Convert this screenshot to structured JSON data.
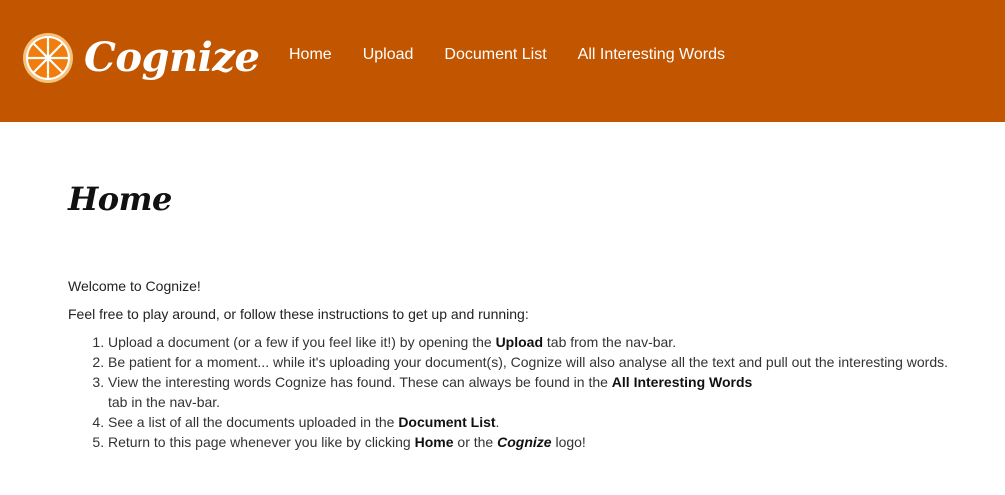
{
  "brand": {
    "name": "Cognize",
    "logo_icon": "orange-slice-icon"
  },
  "nav": {
    "items": [
      {
        "label": "Home"
      },
      {
        "label": "Upload"
      },
      {
        "label": "Document List"
      },
      {
        "label": "All Interesting Words"
      }
    ]
  },
  "page": {
    "title": "Home",
    "welcome": "Welcome to Cognize!",
    "intro": "Feel free to play around, or follow these instructions to get up and running:"
  },
  "steps": [
    {
      "pre": "Upload a document (or a few if you feel like it!) by opening the ",
      "bold": "Upload",
      "post": " tab from the nav-bar."
    },
    {
      "text": "Be patient for a moment... while it's uploading your document(s), Cognize will also analyse all the text and pull out the interesting words."
    },
    {
      "pre": "View the interesting words Cognize has found. These can always be found in the ",
      "bold": "All Interesting Words",
      "post": "tab in the nav-bar."
    },
    {
      "pre": "See a list of all the documents uploaded in the ",
      "bold": "Document List",
      "post": "."
    },
    {
      "pre": "Return to this page whenever you like by clicking ",
      "bold": "Home",
      "mid": " or the ",
      "bold_italic": "Cognize",
      "post": " logo!"
    }
  ],
  "colors": {
    "navbar": "#c15500",
    "nav_text": "#ffffff",
    "body_text": "#222222"
  }
}
